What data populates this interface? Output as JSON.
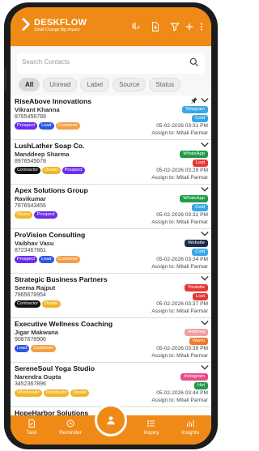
{
  "app": {
    "title": "DESKFLOW",
    "tagline": "Small Change Big Impact"
  },
  "header_icons": [
    "fingerprint-icon",
    "import-icon",
    "filter-icon",
    "plus-icon",
    "more-icon"
  ],
  "search": {
    "placeholder": "Search Contacts"
  },
  "filters": [
    {
      "label": "All",
      "active": true
    },
    {
      "label": "Unread",
      "active": false
    },
    {
      "label": "Label",
      "active": false
    },
    {
      "label": "Source",
      "active": false
    },
    {
      "label": "Status",
      "active": false
    }
  ],
  "colors": {
    "brand": "#f08a16",
    "prospect": "#6a2ee8",
    "lead": "#2d57e0",
    "customer": "#f2a046",
    "contractor": "#111111",
    "dealer": "#f0b62a",
    "wholesaler": "#f0b62a",
    "distributor": "#f0b62a",
    "telegram": "#3aa7e6",
    "whatsapp": "#1f9c4a",
    "website": "#1b2a4a",
    "youtube": "#e53935",
    "instagram": "#e84a8a",
    "cold": "#3aa7e6",
    "lost": "#e53935",
    "warm": "#f07a2a",
    "hot": "#1f9c4a"
  },
  "contacts": [
    {
      "company": "RiseAbove Innovations",
      "contact": "Vikrant Khanna",
      "phone": "8765456789",
      "tags": [
        {
          "label": "Prospect",
          "color": "#6a2ee8"
        },
        {
          "label": "Lead",
          "color": "#2d57e0"
        },
        {
          "label": "Customer",
          "color": "#f2a046"
        }
      ],
      "source": {
        "label": "Telegram",
        "color": "#3aa7e6"
      },
      "status": {
        "label": "Cold",
        "color": "#3aa7e6"
      },
      "date": "05-02-2026 03:31 PM",
      "assign": "Assign to: Mitali Parmar",
      "pinned": true
    },
    {
      "company": "LushLather Soap Co.",
      "contact": "Manddeep Sharma",
      "phone": "8976545678",
      "tags": [
        {
          "label": "Contractor",
          "color": "#111111"
        },
        {
          "label": "Dealer",
          "color": "#f0b62a"
        },
        {
          "label": "Prospect",
          "color": "#6a2ee8"
        }
      ],
      "source": {
        "label": "WhatsApp",
        "color": "#1f9c4a"
      },
      "status": {
        "label": "Lost",
        "color": "#e53935"
      },
      "date": "05-02-2026 03:29 PM",
      "assign": "Assign to: Mitali Parmar",
      "pinned": false
    },
    {
      "company": "Apex Solutions Group",
      "contact": "Ravikumar",
      "phone": "7876543456",
      "tags": [
        {
          "label": "Dealer",
          "color": "#f0b62a"
        },
        {
          "label": "Prospect",
          "color": "#6a2ee8"
        }
      ],
      "source": {
        "label": "WhatsApp",
        "color": "#1f9c4a"
      },
      "status": {
        "label": "Cold",
        "color": "#3aa7e6"
      },
      "date": "05-02-2026 03:31 PM",
      "assign": "Assign to: Mitali Parmar",
      "pinned": false
    },
    {
      "company": "ProVision Consulting",
      "contact": "Vaibhav Vasu",
      "phone": "8723467861",
      "tags": [
        {
          "label": "Prospect",
          "color": "#6a2ee8"
        },
        {
          "label": "Lead",
          "color": "#2d57e0"
        },
        {
          "label": "Customer",
          "color": "#f2a046"
        }
      ],
      "source": {
        "label": "Website",
        "color": "#1b2a4a"
      },
      "status": {
        "label": "Cold",
        "color": "#3aa7e6"
      },
      "date": "05-02-2026 03:34 PM",
      "assign": "Assign to: Mitali Parmar",
      "pinned": false
    },
    {
      "company": "Strategic Business Partners",
      "contact": "Seema Rajput",
      "phone": "7865678954",
      "tags": [
        {
          "label": "Contractor",
          "color": "#111111"
        },
        {
          "label": "Dealer",
          "color": "#f0b62a"
        }
      ],
      "source": {
        "label": "Youtube",
        "color": "#e53935"
      },
      "status": {
        "label": "Lost",
        "color": "#e53935"
      },
      "date": "05-02-2026 03:37 PM",
      "assign": "Assign to: Mitali Parmar",
      "pinned": false
    },
    {
      "company": "Executive Wellness Coaching",
      "contact": "Jigar Makwana",
      "phone": "9087678906",
      "tags": [
        {
          "label": "Lead",
          "color": "#2d57e0"
        },
        {
          "label": "Customer",
          "color": "#f2a046"
        }
      ],
      "source": {
        "label": "Referral",
        "color": "#f0a0a0"
      },
      "status": {
        "label": "Warm",
        "color": "#f07a2a"
      },
      "date": "05-02-2026 03:39 PM",
      "assign": "Assign to: Mitali Parmar",
      "pinned": false
    },
    {
      "company": "SereneSoul Yoga Studio",
      "contact": "Narendra Gupta",
      "phone": "3452367896",
      "tags": [
        {
          "label": "Wholesaler",
          "color": "#f0b62a"
        },
        {
          "label": "Distributor",
          "color": "#f0b62a"
        },
        {
          "label": "Dealer",
          "color": "#f0b62a"
        }
      ],
      "source": {
        "label": "Instagram",
        "color": "#e84a8a"
      },
      "status": {
        "label": "Hot",
        "color": "#1f9c4a"
      },
      "date": "05-02-2026 03:44 PM",
      "assign": "Assign to: Mitali Parmar",
      "pinned": false
    },
    {
      "company": "HopeHarbor Solutions",
      "contact": "",
      "phone": "",
      "tags": [],
      "source": null,
      "status": null,
      "date": "",
      "assign": "",
      "pinned": false
    }
  ],
  "bottom_nav": [
    {
      "label": "Task",
      "icon": "task-icon"
    },
    {
      "label": "Reminder",
      "icon": "clock-icon"
    },
    {
      "label": "Inquiry",
      "icon": "list-icon"
    },
    {
      "label": "Insights",
      "icon": "chart-icon"
    }
  ],
  "fab": {
    "icon": "person-icon"
  }
}
